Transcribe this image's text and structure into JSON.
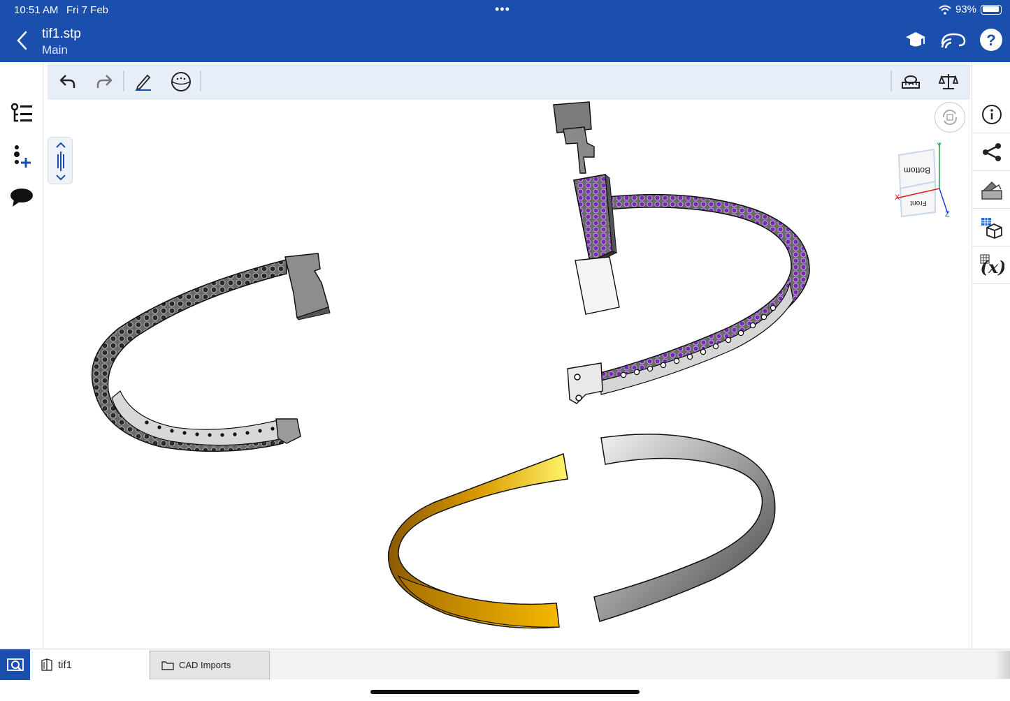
{
  "status": {
    "time": "10:51 AM",
    "date": "Fri 7 Feb",
    "battery": "93%"
  },
  "header": {
    "title": "tif1.stp",
    "subtitle": "Main"
  },
  "view_cube": {
    "face_top": "Bottom",
    "face_front": "Front",
    "axis_x": "X",
    "axis_y": "Y",
    "axis_z": "Z"
  },
  "tabs": {
    "document": "tif1",
    "folder": "CAD Imports"
  },
  "colors": {
    "brand": "#1a4fad",
    "gem": "#7a28b8",
    "gold": "#f0b400",
    "metal": "#555555"
  },
  "icons": {
    "header": [
      "back-icon",
      "learning-icon",
      "connect-icon",
      "help-icon"
    ],
    "left": [
      "feature-list-icon",
      "add-part-icon",
      "comment-icon"
    ],
    "toolbar": [
      "undo-icon",
      "redo-icon",
      "sketch-icon",
      "named-views-icon",
      "measure-icon",
      "mass-properties-icon"
    ],
    "right": [
      "info-icon",
      "share-icon",
      "appearance-icon",
      "configurations-icon",
      "variables-icon"
    ]
  }
}
